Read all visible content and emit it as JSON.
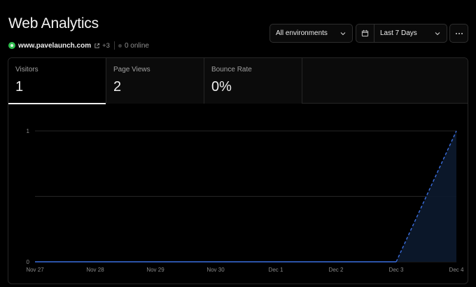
{
  "header": {
    "title": "Web Analytics",
    "domain": "www.pavelaunch.com",
    "more_domains": "+3",
    "online": "0 online"
  },
  "controls": {
    "environment": "All environments",
    "date_range": "Last 7 Days"
  },
  "tabs": [
    {
      "label": "Visitors",
      "value": "1",
      "active": true
    },
    {
      "label": "Page Views",
      "value": "2",
      "active": false
    },
    {
      "label": "Bounce Rate",
      "value": "0%",
      "active": false
    }
  ],
  "colors": {
    "accent_line": "#3b6fe0",
    "status_green": "#2fbf4f"
  },
  "icons": {
    "status": "status-dot-icon",
    "external": "external-link-icon",
    "chevron": "chevron-down-icon",
    "calendar": "calendar-icon",
    "more": "more-horizontal-icon"
  },
  "chart_data": {
    "type": "area",
    "categories": [
      "Nov 27",
      "Nov 28",
      "Nov 29",
      "Nov 30",
      "Dec 1",
      "Dec 2",
      "Dec 3",
      "Dec 4"
    ],
    "values": [
      0,
      0,
      0,
      0,
      0,
      0,
      0,
      1
    ],
    "ylim": [
      0,
      1
    ],
    "yticks": [
      "0",
      "1"
    ],
    "grid": true,
    "last_segment_dashed": true
  }
}
